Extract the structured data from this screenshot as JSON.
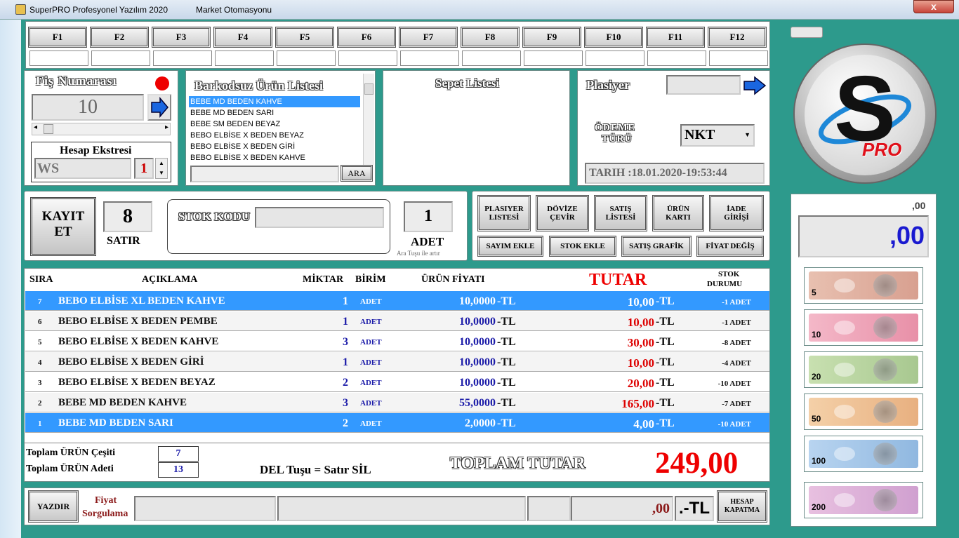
{
  "titlebar": {
    "app_title": "SuperPRO Profesyonel Yazılım 2020",
    "subtitle": "Market Otomasyonu",
    "close_label": "x"
  },
  "fkeys": [
    "F1",
    "F2",
    "F3",
    "F4",
    "F5",
    "F6",
    "F7",
    "F8",
    "F9",
    "F10",
    "F11",
    "F12"
  ],
  "fis": {
    "label": "Fiş Numarası",
    "number": "10"
  },
  "hesap": {
    "label": "Hesap Ekstresi",
    "code": "WS",
    "count": "1"
  },
  "barkodsuz": {
    "label": "Barkodsuz Ürün Listesi",
    "items": [
      "BEBE MD BEDEN KAHVE",
      "BEBE MD BEDEN SARI",
      "BEBE SM BEDEN BEYAZ",
      "BEBO ELBİSE X BEDEN BEYAZ",
      "BEBO ELBİSE X BEDEN GİRİ",
      "BEBO ELBİSE X BEDEN KAHVE"
    ],
    "search_button": "ARA"
  },
  "sepet": {
    "label": "Sepet Listesi"
  },
  "plasiyer": {
    "label": "Plasiyer",
    "odeme_label_1": "ÖDEME",
    "odeme_label_2": "TÜRÜ",
    "odeme_value": "NKT",
    "date": "TARIH :18.01.2020-19:53:44"
  },
  "entry": {
    "kayit_1": "KAYIT",
    "kayit_2": "ET",
    "satir_value": "8",
    "satir_label": "SATIR",
    "stok_label": "STOK KODU",
    "adet_value": "1",
    "adet_label": "ADET",
    "adet_hint": "Ara Tuşu ile artır"
  },
  "actions": {
    "row1": [
      "PLASIYER LISTESİ",
      "DÖVİZE ÇEVİR",
      "SATIŞ LİSTESİ",
      "ÜRÜN KARTI",
      "İADE GİRİŞİ"
    ],
    "row2": [
      "SAYIM EKLE",
      "STOK EKLE",
      "SATIŞ GRAFİK",
      "FİYAT DEĞİŞ"
    ]
  },
  "grid": {
    "headers": {
      "sira": "SIRA",
      "aciklama": "AÇIKLAMA",
      "miktar": "MİKTAR",
      "birim": "BİRİM",
      "fiyat": "ÜRÜN FİYATI",
      "tutar": "TUTAR",
      "stok_1": "STOK",
      "stok_2": "DURUMU"
    },
    "rows": [
      {
        "sira": "7",
        "aciklama": "BEBO ELBİSE XL BEDEN KAHVE",
        "miktar": "1",
        "birim": "ADET",
        "fiyat": "10,0000",
        "tl1": "-TL",
        "tutar": "10,00",
        "tl2": "-TL",
        "stok": "-1 ADET"
      },
      {
        "sira": "6",
        "aciklama": "BEBO ELBİSE X BEDEN PEMBE",
        "miktar": "1",
        "birim": "ADET",
        "fiyat": "10,0000",
        "tl1": "-TL",
        "tutar": "10,00",
        "tl2": "-TL",
        "stok": "-1 ADET"
      },
      {
        "sira": "5",
        "aciklama": "BEBO ELBİSE X BEDEN KAHVE",
        "miktar": "3",
        "birim": "ADET",
        "fiyat": "10,0000",
        "tl1": "-TL",
        "tutar": "30,00",
        "tl2": "-TL",
        "stok": "-8 ADET"
      },
      {
        "sira": "4",
        "aciklama": "BEBO ELBİSE X BEDEN GİRİ",
        "miktar": "1",
        "birim": "ADET",
        "fiyat": "10,0000",
        "tl1": "-TL",
        "tutar": "10,00",
        "tl2": "-TL",
        "stok": "-4 ADET"
      },
      {
        "sira": "3",
        "aciklama": "BEBO ELBİSE X BEDEN BEYAZ",
        "miktar": "2",
        "birim": "ADET",
        "fiyat": "10,0000",
        "tl1": "-TL",
        "tutar": "20,00",
        "tl2": "-TL",
        "stok": "-10 ADET"
      },
      {
        "sira": "2",
        "aciklama": "BEBE MD BEDEN KAHVE",
        "miktar": "3",
        "birim": "ADET",
        "fiyat": "55,0000",
        "tl1": "-TL",
        "tutar": "165,00",
        "tl2": "-TL",
        "stok": "-7 ADET"
      },
      {
        "sira": "1",
        "aciklama": "BEBE MD BEDEN SARI",
        "miktar": "2",
        "birim": "ADET",
        "fiyat": "2,0000",
        "tl1": "-TL",
        "tutar": "4,00",
        "tl2": "-TL",
        "stok": "-10 ADET"
      }
    ]
  },
  "totals": {
    "cesit_label": "Toplam ÜRÜN Çeşiti",
    "cesit_value": "7",
    "adet_label": "Toplam ÜRÜN Adeti",
    "adet_value": "13",
    "del_hint": "DEL Tuşu = Satır SİL",
    "toplam_label": "TOPLAM TUTAR",
    "toplam_value": "249,00"
  },
  "bottom": {
    "print_button": "YAZDIR",
    "fiyat_1": "Fiyat",
    "fiyat_2": "Sorgulama",
    "amount": ",00",
    "currency": ".-TL",
    "hesap_1": "HESAP",
    "hesap_2": "KAPATMA"
  },
  "right": {
    "logo_text": "PRO",
    "small_amount": ",00",
    "big_amount": ",00"
  },
  "banknotes": [
    "5",
    "10",
    "20",
    "50",
    "100",
    "200"
  ]
}
